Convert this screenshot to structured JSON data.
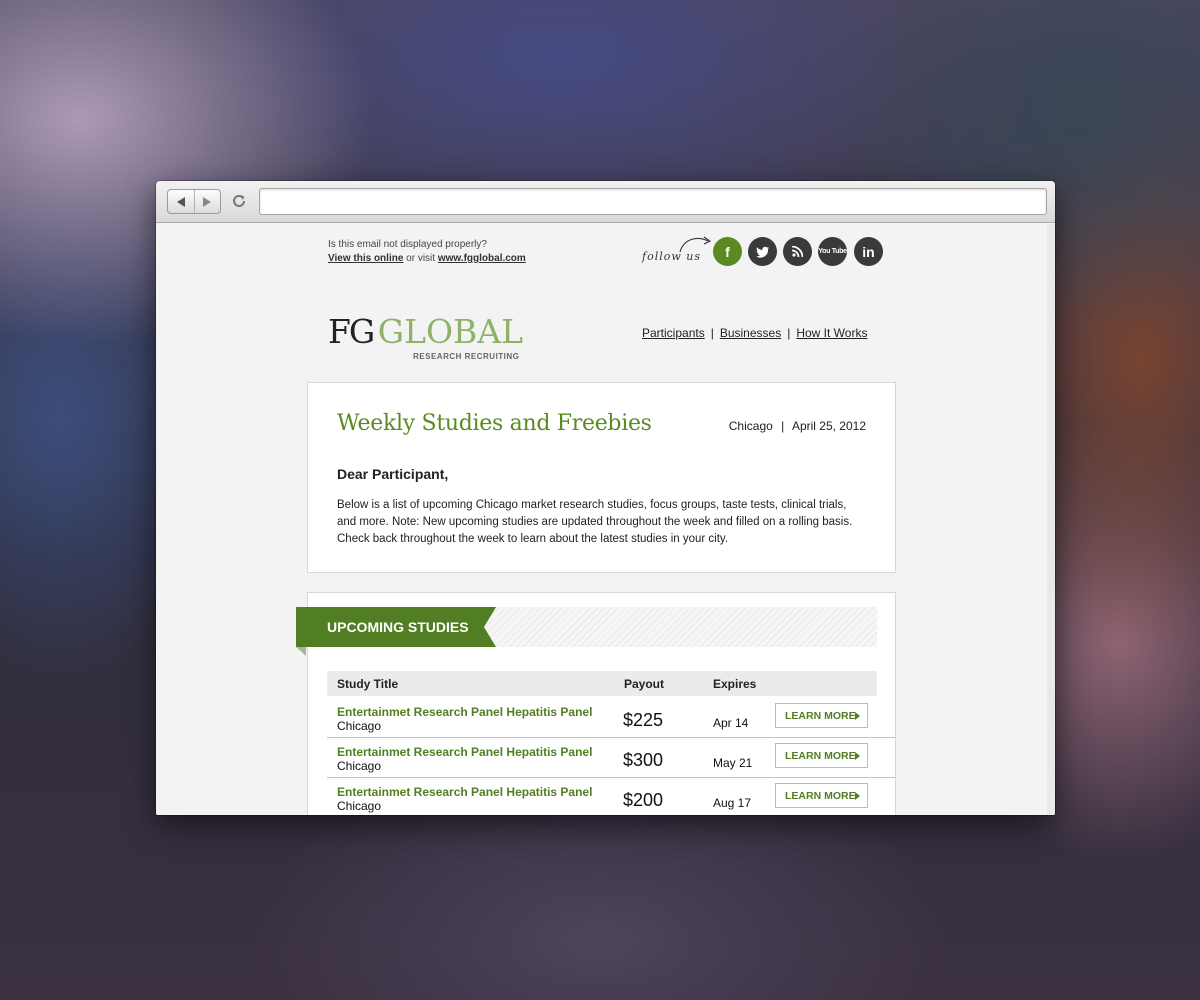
{
  "browser": {
    "url": ""
  },
  "email": {
    "pre_header": {
      "question": "Is this email not displayed properly?",
      "view_online": "View this online",
      "or_visit": " or visit ",
      "site_link": "www.fgglobal.com"
    },
    "follow_us": "follow us",
    "social": [
      "facebook",
      "twitter",
      "rss",
      "youtube",
      "linkedin"
    ],
    "social_labels": {
      "facebook": "f",
      "twitter": "t",
      "rss": "rss",
      "youtube": "You Tube",
      "linkedin": "in"
    },
    "logo": {
      "fg": "FG",
      "global": "GLOBAL",
      "sub": "RESEARCH RECRUITING"
    },
    "nav": [
      "Participants",
      "Businesses",
      "How It Works"
    ],
    "nav_separator": "|",
    "intro": {
      "title": "Weekly Studies and Freebies",
      "city": "Chicago",
      "meta_separator": "|",
      "date": "April 25, 2012",
      "greeting": "Dear Participant,",
      "body": "Below is a list of upcoming Chicago market research studies, focus groups, taste tests, clinical trials, and more. Note: New upcoming studies are updated throughout the week and filled on a rolling basis. Check back throughout the week to learn about the latest studies in your city."
    },
    "studies": {
      "section_title": "UPCOMING STUDIES",
      "columns": [
        "Study Title",
        "Payout",
        "Expires"
      ],
      "rows": [
        {
          "title": "Entertainmet Research Panel Hepatitis Panel",
          "city": "Chicago",
          "payout": "$225",
          "expires": "Apr 14",
          "button": "LEARN MORE"
        },
        {
          "title": "Entertainmet Research Panel Hepatitis Panel",
          "city": "Chicago",
          "payout": "$300",
          "expires": "May 21",
          "button": "LEARN MORE"
        },
        {
          "title": "Entertainmet Research Panel Hepatitis Panel",
          "city": "Chicago",
          "payout": "$200",
          "expires": "Aug 17",
          "button": "LEARN MORE"
        }
      ]
    }
  },
  "colors": {
    "brand_green": "#517e22",
    "title_green": "#5c8a22",
    "logo_light_green": "#8fb26b",
    "facebook_active": "#5c8a22",
    "social_dark": "#3a3a3a"
  }
}
